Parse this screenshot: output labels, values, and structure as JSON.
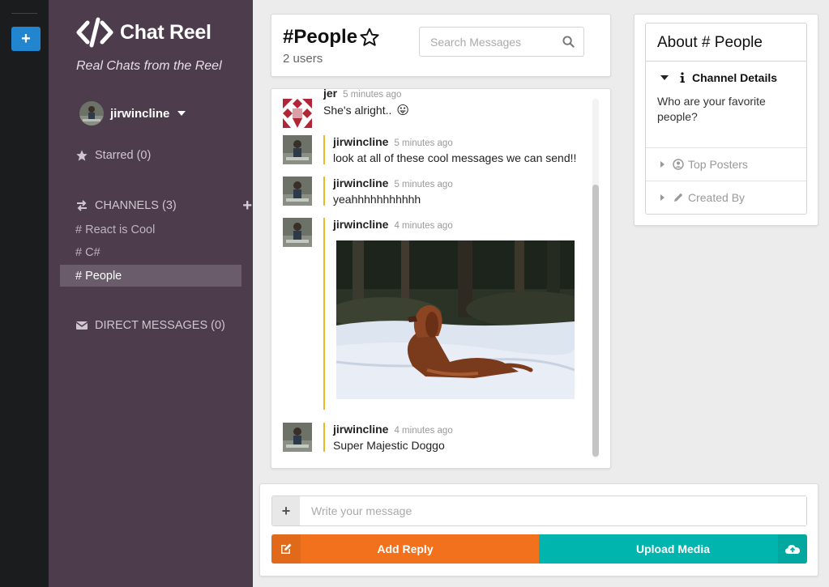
{
  "app": {
    "name": "Chat Reel",
    "tagline": "Real Chats from the Reel",
    "colors": {
      "sidebar": "#4c3c4c",
      "strip": "#1b1c1d",
      "add_button": "#2185d0",
      "reply": "#f2711c",
      "upload": "#00b5ad",
      "accent_border": "#f1b826"
    }
  },
  "strip": {
    "add_label": "+"
  },
  "user": {
    "name": "jirwincline",
    "avatar_icon": "user-avatar"
  },
  "sidebar": {
    "starred_label": "Starred (0)",
    "channels_label": "CHANNELS (3)",
    "channels_add": "+",
    "channels": [
      {
        "label": "# React is Cool",
        "active": false
      },
      {
        "label": "# C#",
        "active": false
      },
      {
        "label": "# People",
        "active": true
      }
    ],
    "direct_messages_label": "DIRECT MESSAGES (0)"
  },
  "channel": {
    "title": "#People",
    "users": "2 users",
    "search_placeholder": "Search Messages"
  },
  "messages": [
    {
      "author": "jer",
      "time": "5 minutes ago",
      "text": "She's alright..",
      "emoji": "😛",
      "avatar": "identicon",
      "border": false
    },
    {
      "author": "jirwincline",
      "time": "5 minutes ago",
      "text": "look at all of these cool messages we can send!!",
      "avatar": "photo",
      "border": true
    },
    {
      "author": "jirwincline",
      "time": "5 minutes ago",
      "text": "yeahhhhhhhhhhh",
      "avatar": "photo",
      "border": true
    },
    {
      "author": "jirwincline",
      "time": "4 minutes ago",
      "text": "",
      "image": "dog-in-snow",
      "avatar": "photo",
      "border": true
    },
    {
      "author": "jirwincline",
      "time": "4 minutes ago",
      "text": "Super Majestic Doggo",
      "avatar": "photo",
      "border": true
    }
  ],
  "meta": {
    "title": "About # People",
    "sections": [
      {
        "label": "Channel Details",
        "icon": "info-icon",
        "open": true,
        "content": "Who are your favorite people?"
      },
      {
        "label": "Top Posters",
        "icon": "user-circle-icon",
        "open": false
      },
      {
        "label": "Created By",
        "icon": "pencil-icon",
        "open": false
      }
    ]
  },
  "composer": {
    "plus_label": "+",
    "placeholder": "Write your message",
    "reply_label": "Add Reply",
    "upload_label": "Upload Media"
  }
}
